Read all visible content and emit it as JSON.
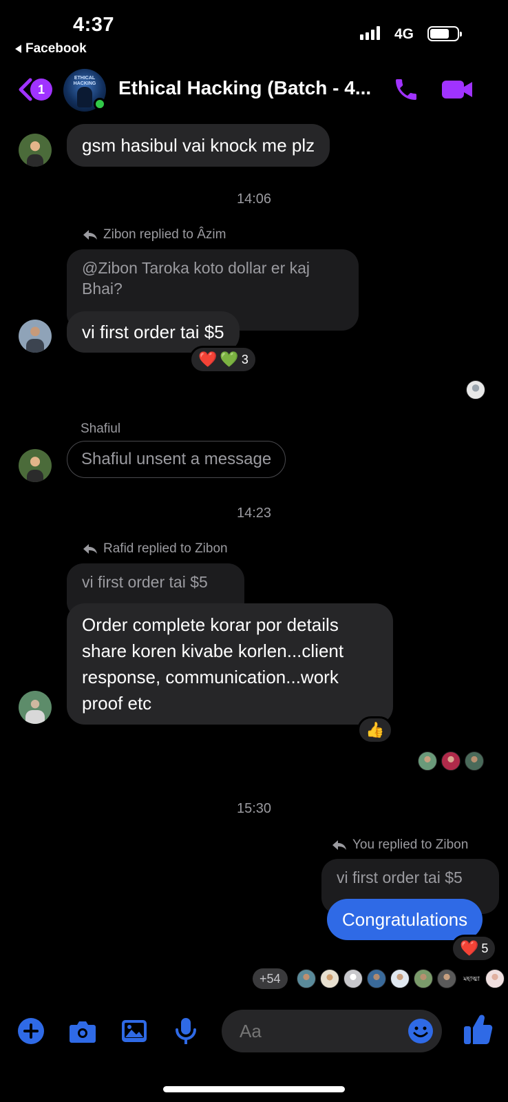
{
  "status_bar": {
    "time": "4:37",
    "back_app": "Facebook",
    "network": "4G"
  },
  "header": {
    "unread_badge": "1",
    "title": "Ethical Hacking (Batch - 4...",
    "group_avatar_text": "ETHICAL HACKING",
    "colors": {
      "accent": "#a033ff",
      "online": "#31c948"
    }
  },
  "messages": {
    "shafiul_msg": "gsm hasibul vai knock me plz",
    "ts1": "14:06",
    "reply1_label": "Zibon replied to Âzim",
    "reply1_quote": "@Zibon Taroka koto dollar er kaj Bhai?",
    "reply1_text": "vi first order tai $5",
    "reply1_reaction_count": "3",
    "sender_shafiul": "Shafiul",
    "unsent_text": "Shafiul unsent a message",
    "ts2": "14:23",
    "reply2_label": "Rafid replied to Zibon",
    "reply2_quote": "vi first order tai $5",
    "reply2_text": "Order complete korar por details share koren kivabe korlen...client response, communication...work proof etc",
    "ts3": "15:30",
    "reply3_label": "You replied to Zibon",
    "reply3_quote": "vi first order tai $5",
    "reply3_text": "Congratulations",
    "reply3_reaction_count": "5",
    "seen_more": "+54",
    "seen_tag": "মহাত্মা"
  },
  "composer": {
    "placeholder": "Aa",
    "accent": "#2f6ae6"
  }
}
